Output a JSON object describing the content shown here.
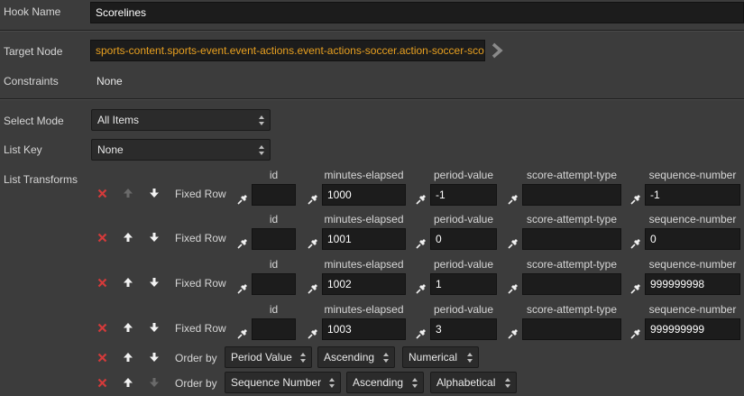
{
  "hook_name": {
    "label": "Hook Name",
    "value": "Scorelines"
  },
  "target_node": {
    "label": "Target Node",
    "value": "sports-content.sports-event.event-actions.event-actions-soccer.action-soccer-score"
  },
  "constraints": {
    "label": "Constraints",
    "value": "None"
  },
  "select_mode": {
    "label": "Select Mode",
    "value": "All Items"
  },
  "list_key": {
    "label": "List Key",
    "value": "None"
  },
  "list_transforms": {
    "label": "List Transforms",
    "columns": [
      "id",
      "minutes-elapsed",
      "period-value",
      "score-attempt-type",
      "sequence-number"
    ],
    "rows": [
      {
        "type": "Fixed Row",
        "values": [
          "",
          "1000",
          "-1",
          "",
          "-1"
        ]
      },
      {
        "type": "Fixed Row",
        "values": [
          "",
          "1001",
          "0",
          "",
          "0"
        ]
      },
      {
        "type": "Fixed Row",
        "values": [
          "",
          "1002",
          "1",
          "",
          "999999998"
        ]
      },
      {
        "type": "Fixed Row",
        "values": [
          "",
          "1003",
          "3",
          "",
          "999999999"
        ]
      }
    ],
    "order_rows": [
      {
        "label": "Order by",
        "field": "Period Value",
        "direction": "Ascending",
        "kind": "Numerical"
      },
      {
        "label": "Order by",
        "field": "Sequence Number",
        "direction": "Ascending",
        "kind": "Alphabetical"
      }
    ]
  },
  "icons": {
    "remove": "close-icon",
    "move_up": "arrow-up-icon",
    "move_down": "arrow-down-icon",
    "pin": "pin-icon",
    "navigate": "chevron-right-icon"
  },
  "colors": {
    "background": "#3c3c3c",
    "field": "#1c1c1c",
    "accent_orange": "#e8a020",
    "remove_red": "#d43a3a"
  }
}
